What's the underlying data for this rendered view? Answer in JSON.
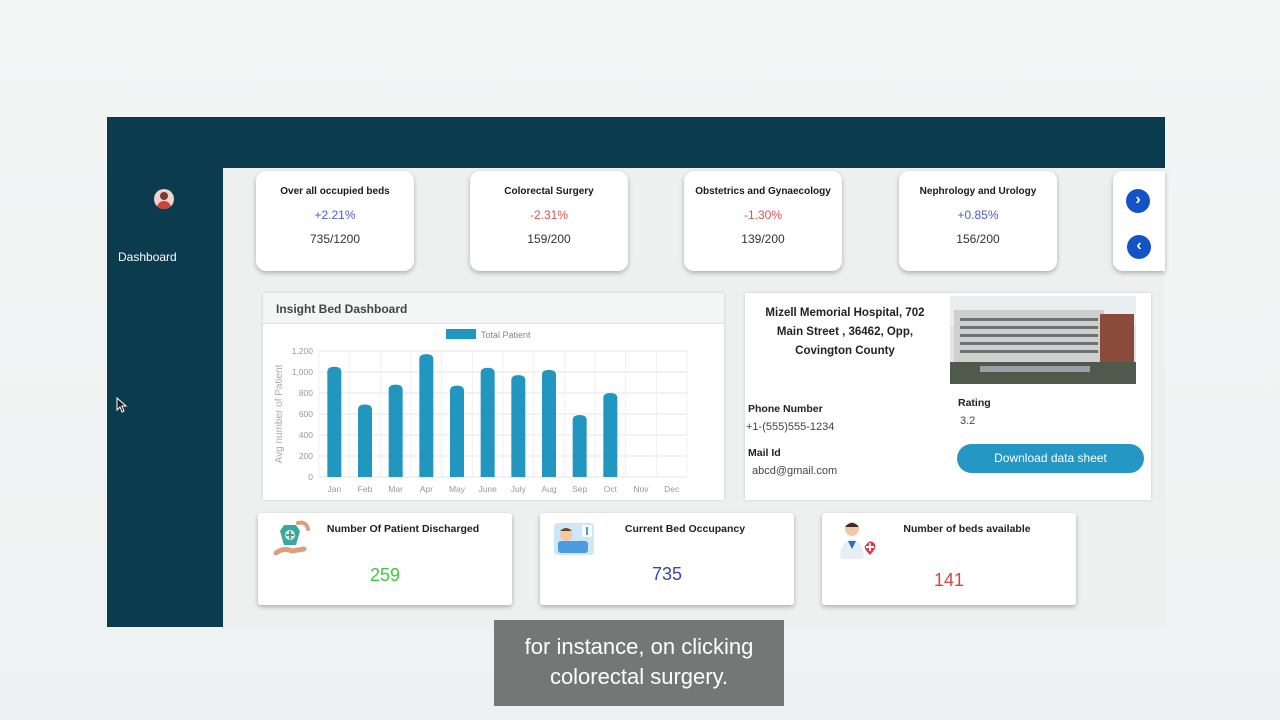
{
  "sidebar": {
    "nav_label": "Dashboard"
  },
  "stats": [
    {
      "title": "Over all occupied beds",
      "change": "+2.21%",
      "trend": "up",
      "value": "735/1200"
    },
    {
      "title": "Colorectal Surgery",
      "change": "-2.31%",
      "trend": "down",
      "value": "159/200"
    },
    {
      "title": "Obstetrics and Gynaecology",
      "change": "-1.30%",
      "trend": "down",
      "value": "139/200"
    },
    {
      "title": "Nephrology and Urology",
      "change": "+0.85%",
      "trend": "up",
      "value": "156/200"
    }
  ],
  "nav_arrows": {
    "next_icon": "chevron-right-icon",
    "prev_icon": "chevron-left-icon"
  },
  "chart_panel": {
    "title": "Insight Bed Dashboard"
  },
  "chart_data": {
    "type": "bar",
    "title": "",
    "legend": "Total Patient",
    "legend_position": "top-center",
    "ylabel": "Avg number of Patient",
    "xlabel": "",
    "categories": [
      "Jan",
      "Feb",
      "Mar",
      "Apr",
      "May",
      "June",
      "July",
      "Aug",
      "Sep",
      "Oct",
      "Nov",
      "Dec"
    ],
    "values": [
      1050,
      690,
      880,
      1170,
      870,
      1040,
      970,
      1020,
      590,
      800,
      null,
      null
    ],
    "ylim": [
      0,
      1200
    ],
    "yticks": [
      "0",
      "200",
      "400",
      "600",
      "800",
      "1,000",
      "1,200"
    ],
    "grid": true,
    "color": "#2196bf"
  },
  "hospital": {
    "name": "Mizell Memorial Hospital, 702 Main Street , 36462, Opp, Covington County",
    "phone_label": "Phone Number",
    "phone": "+1-(555)555-1234",
    "mail_label": "Mail Id",
    "mail": "abcd@gmail.com",
    "rating_label": "Rating",
    "rating": "3.2",
    "download_label": "Download data sheet"
  },
  "summary": [
    {
      "title": "Number Of Patient Discharged",
      "value": "259",
      "color": "#3ec93e",
      "icon": "patient-care-icon"
    },
    {
      "title": "Current Bed Occupancy",
      "value": "735",
      "color": "#3b47a6",
      "icon": "patient-bed-icon"
    },
    {
      "title": "Number of beds available",
      "value": "141",
      "color": "#d6453a",
      "icon": "doctor-icon"
    }
  ],
  "caption": {
    "line1": "for instance, on clicking",
    "line2": "colorectal surgery."
  }
}
